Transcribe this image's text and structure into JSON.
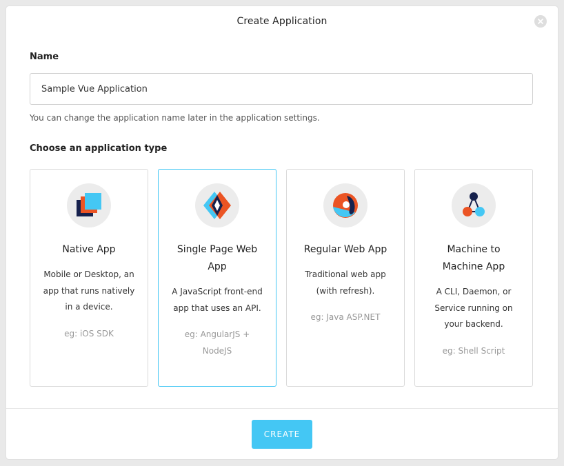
{
  "modal": {
    "title": "Create Application",
    "close_icon": "close-icon"
  },
  "name_field": {
    "label": "Name",
    "value": "Sample Vue Application",
    "help": "You can change the application name later in the application settings."
  },
  "app_type": {
    "label": "Choose an application type",
    "selected": "spa",
    "cards": [
      {
        "id": "native",
        "icon": "native-app-icon",
        "title_lines": [
          "Native App"
        ],
        "desc_lines": [
          "Mobile or Desktop, an",
          "app that runs natively",
          "in a device."
        ],
        "example_lines": [
          "eg: iOS SDK"
        ]
      },
      {
        "id": "spa",
        "icon": "single-page-web-app-icon",
        "title_lines": [
          "Single Page Web",
          "App"
        ],
        "desc_lines": [
          "A JavaScript front-end",
          "app that uses an API."
        ],
        "example_lines": [
          "eg: AngularJS +",
          "NodeJS"
        ]
      },
      {
        "id": "regular",
        "icon": "regular-web-app-icon",
        "title_lines": [
          "Regular Web App"
        ],
        "desc_lines": [
          "Traditional web app",
          "(with refresh)."
        ],
        "example_lines": [
          "eg: Java ASP.NET"
        ]
      },
      {
        "id": "m2m",
        "icon": "machine-to-machine-icon",
        "title_lines": [
          "Machine to",
          "Machine App"
        ],
        "desc_lines": [
          "A CLI, Daemon, or",
          "Service running on",
          "your backend."
        ],
        "example_lines": [
          "eg: Shell Script"
        ]
      }
    ]
  },
  "footer": {
    "create_label": "CREATE"
  },
  "colors": {
    "accent": "#44c7f4",
    "orange": "#eb5424",
    "navy": "#16214d",
    "light_blue": "#44c7f4"
  }
}
